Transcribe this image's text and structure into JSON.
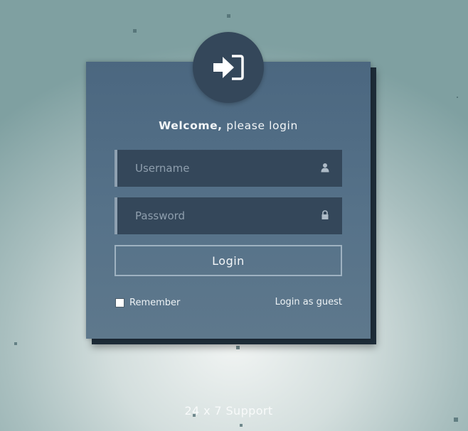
{
  "header": {
    "welcome_strong": "Welcome,",
    "welcome_rest": " please login"
  },
  "form": {
    "username_placeholder": "Username",
    "username_value": "",
    "password_placeholder": "Password",
    "password_value": "",
    "login_label": "Login",
    "remember_label": "Remember",
    "remember_checked": false,
    "guest_label": "Login as guest"
  },
  "footer": {
    "support_label": "24 x 7 Support"
  },
  "icons": {
    "badge": "sign-in-icon",
    "username": "user-icon",
    "password": "lock-icon"
  },
  "colors": {
    "card": "#567289",
    "field": "#34475a",
    "field_accent": "#8fa1b1",
    "text": "#f3f6f8",
    "placeholder": "#8f9fae"
  }
}
